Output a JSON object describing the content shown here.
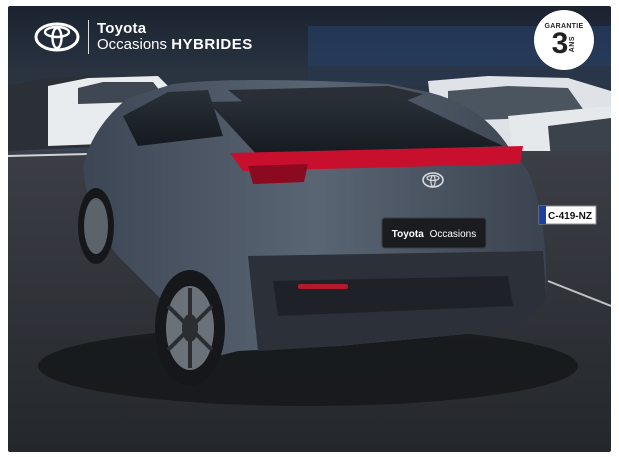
{
  "brand": {
    "name": "Toyota",
    "subtitle_prefix": "Occasions",
    "subtitle_strong": "HYBRIDES"
  },
  "warranty_badge": {
    "label": "GARANTIE",
    "number": "3",
    "unit": "ANS"
  },
  "car": {
    "tailgate_badge": {
      "brand": "Toyota",
      "suffix": "Occasions"
    },
    "neighbor_plate": "C-419-NZ"
  },
  "colors": {
    "car_body": "#4a5563",
    "taillight": "#c8102e",
    "asphalt": "#2e3136",
    "sky": "#1f2a3a"
  }
}
